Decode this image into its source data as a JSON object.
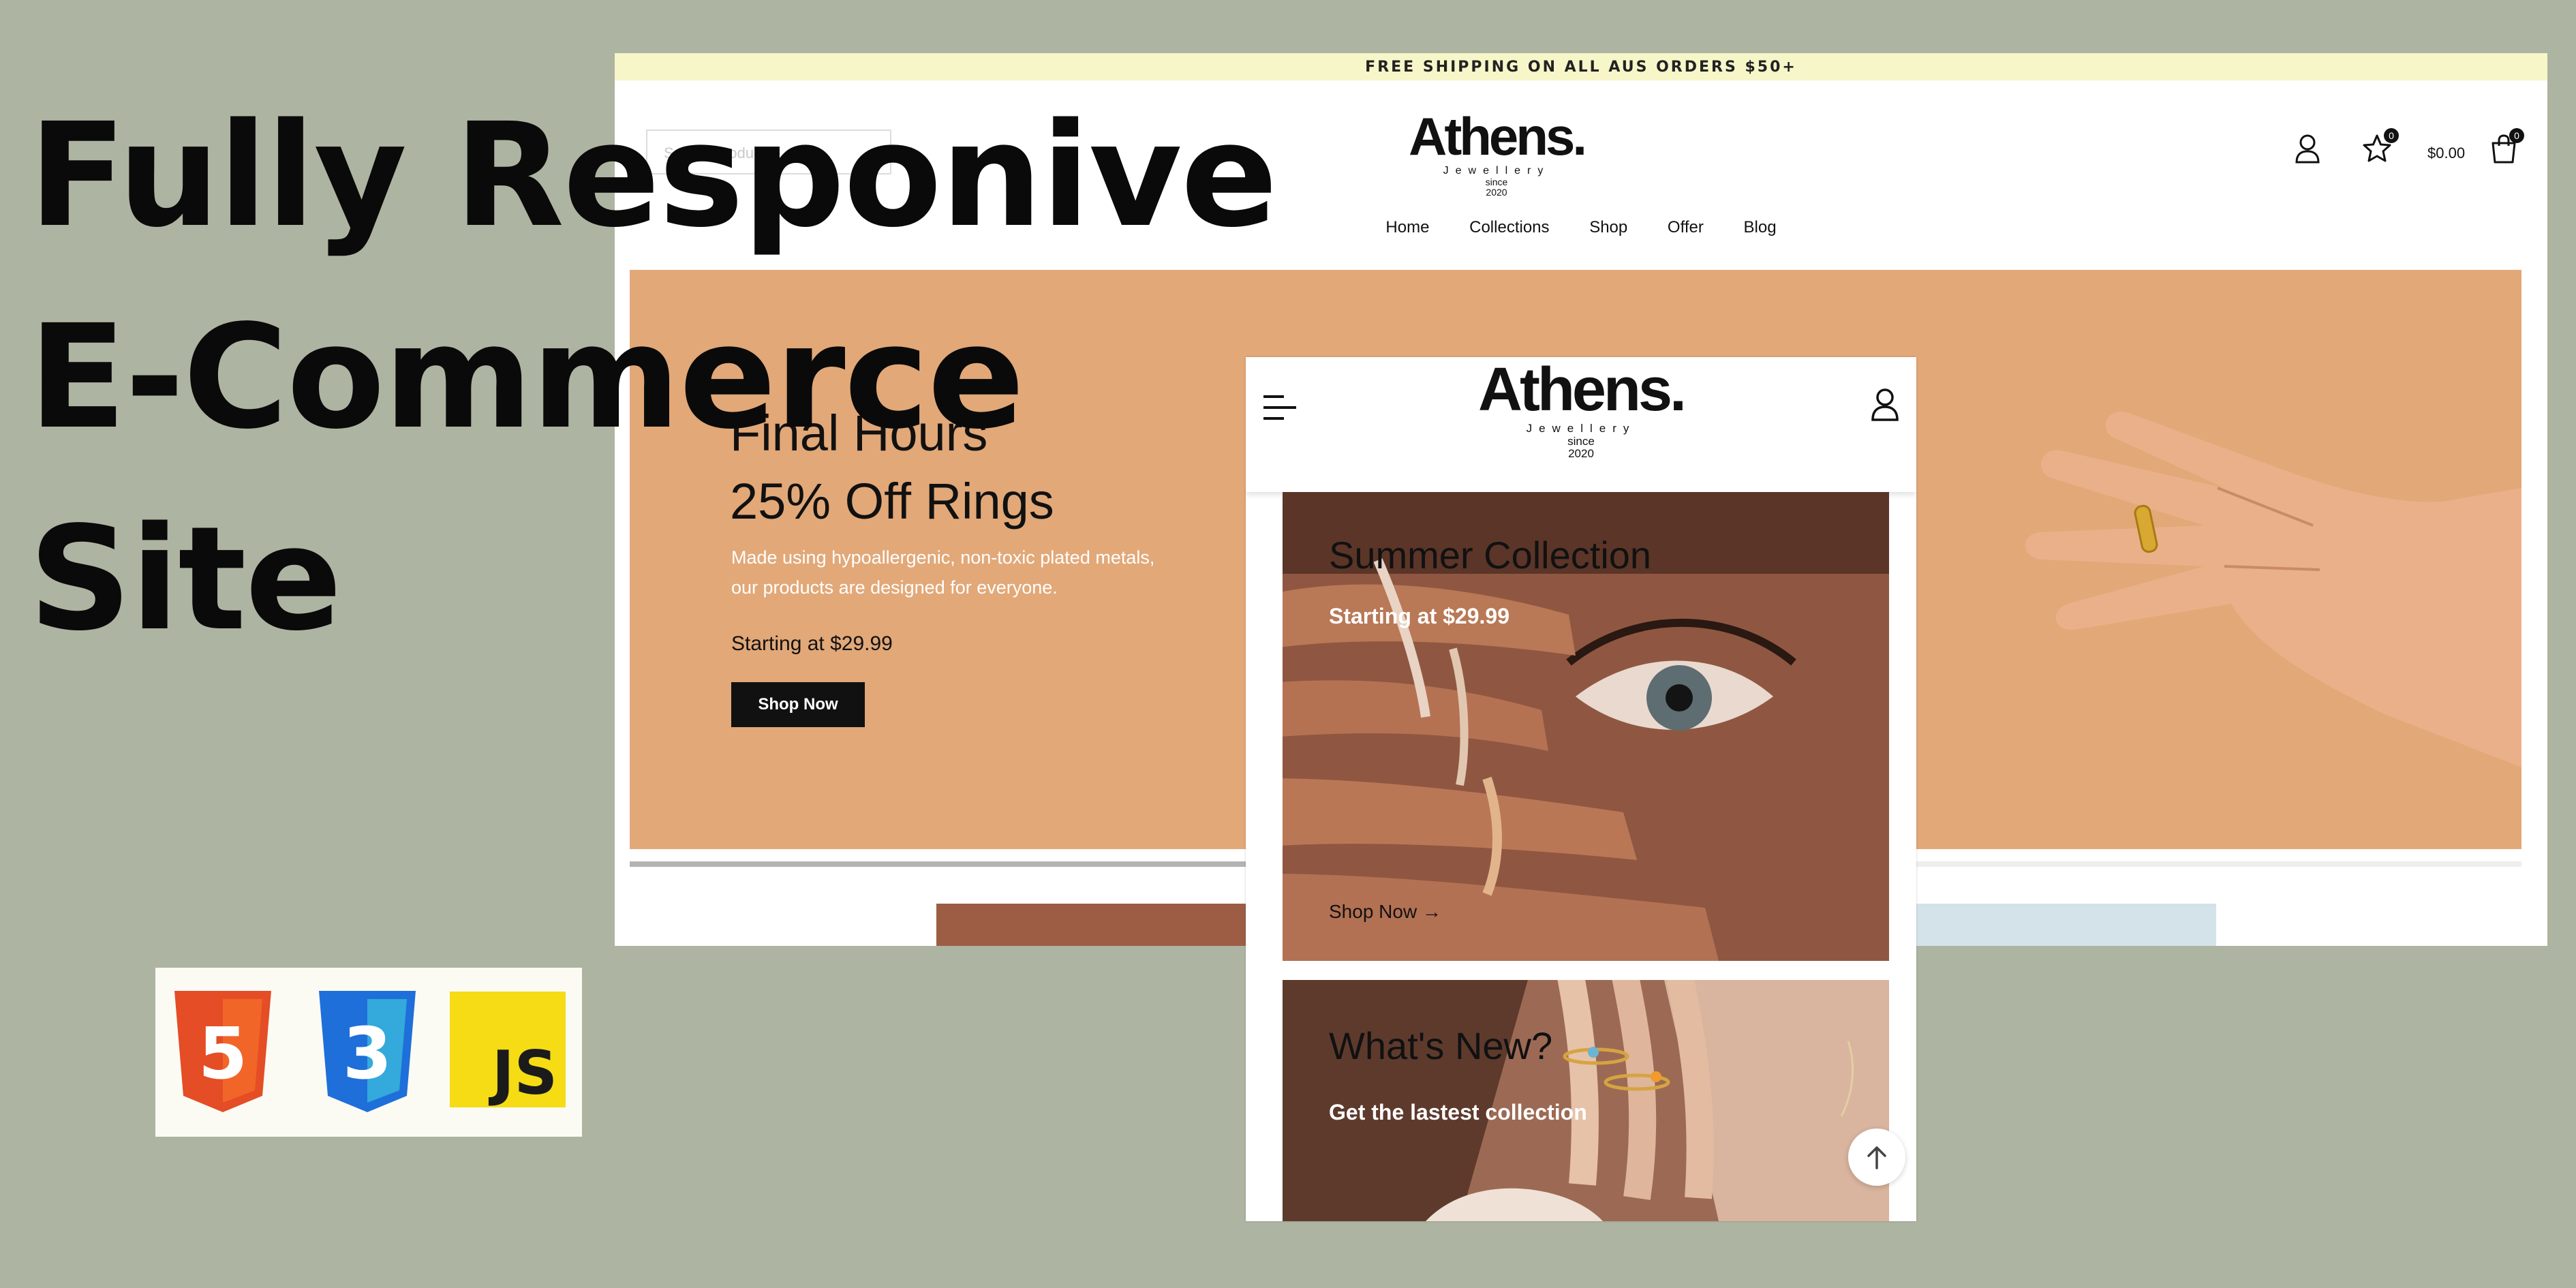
{
  "headline": {
    "line1": "Fully Responive",
    "line2": "E-Commerce",
    "line3": "Site"
  },
  "tech_badges": {
    "html_number": "5",
    "css_number": "3",
    "js_label": "JS",
    "html_color": "#e44d26",
    "css_color": "#1e6fd9",
    "js_color": "#f5dc14"
  },
  "desktop": {
    "announcement": "FREE SHIPPING ON ALL AUS ORDERS $50+",
    "search_placeholder": "Search products...",
    "logo": {
      "name": "Athens.",
      "tagline": "Jewellery",
      "since": "since",
      "year": "2020"
    },
    "nav": [
      "Home",
      "Collections",
      "Shop",
      "Offer",
      "Blog"
    ],
    "wishlist_count": "0",
    "cart_total": "$0.00",
    "cart_count": "0",
    "hero": {
      "title_line1": "Final Hours",
      "title_line2": "25% Off Rings",
      "description_line1": "Made using hypoallergenic, non-toxic plated metals,",
      "description_line2": "our products are designed for everyone.",
      "price": "Starting at $29.99",
      "cta": "Shop Now",
      "background_color": "#e2a878"
    }
  },
  "mobile": {
    "logo": {
      "name": "Athens.",
      "tagline": "Jewellery",
      "since": "since",
      "year": "2020"
    },
    "card1": {
      "title": "Summer Collection",
      "subtitle": "Starting at $29.99",
      "link": "Shop Now →"
    },
    "card2": {
      "title": "What's New?",
      "subtitle": "Get the lastest collection"
    }
  }
}
